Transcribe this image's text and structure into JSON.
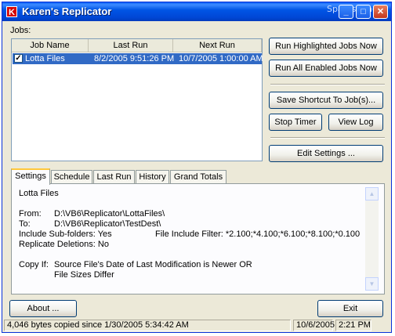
{
  "window": {
    "title": "Karen's Replicator",
    "app_icon_letter": "K",
    "watermark": "SparksSpace"
  },
  "window_controls": {
    "minimize": "_",
    "maximize": "□",
    "close": "✕"
  },
  "jobs_label": "Jobs:",
  "jobs_table": {
    "headers": [
      "Job Name",
      "Last Run",
      "Next Run"
    ],
    "rows": [
      {
        "checked": true,
        "checkmark": "✓",
        "name": "Lotta Files",
        "last_run": "8/2/2005 9:51:26 PM",
        "next_run": "10/7/2005 1:00:00 AM",
        "selected": true
      }
    ]
  },
  "buttons": {
    "run_highlighted": "Run Highlighted Jobs Now",
    "run_all": "Run All Enabled Jobs Now",
    "save_shortcut": "Save Shortcut To Job(s)...",
    "stop_timer": "Stop Timer",
    "view_log": "View Log",
    "edit_settings": "Edit Settings ...",
    "about": "About ...",
    "exit": "Exit"
  },
  "tabs": [
    {
      "label": "Settings",
      "active": true
    },
    {
      "label": "Schedule"
    },
    {
      "label": "Last Run"
    },
    {
      "label": "History"
    },
    {
      "label": "Grand Totals"
    }
  ],
  "settings": {
    "job_name": "Lotta Files",
    "from_label": "From:",
    "from_path": "D:\\VB6\\Replicator\\LottaFiles\\",
    "to_label": "To:",
    "to_path": "D:\\VB6\\Replicator\\TestDest\\",
    "include_subfolders": "Include Sub-folders: Yes",
    "file_include_filter": "File Include Filter: *2.100;*4.100;*6.100;*8.100;*0.100",
    "replicate_deletions": "Replicate Deletions: No",
    "copy_if_label": "Copy  If:",
    "copy_if_line1": "Source File's Date of Last Modification is Newer OR",
    "copy_if_line2": "File Sizes Differ"
  },
  "scrollbar": {
    "up_arrow": "▲",
    "down_arrow": "▼"
  },
  "status": {
    "message": "4,046 bytes copied since 1/30/2005 5:34:42 AM",
    "date": "10/6/2005",
    "time": "2:21 PM"
  },
  "colors": {
    "title_bar": "#0055e5",
    "selection": "#316ac5",
    "window_bg": "#ece9d8",
    "tab_accent": "#ffc83c"
  }
}
